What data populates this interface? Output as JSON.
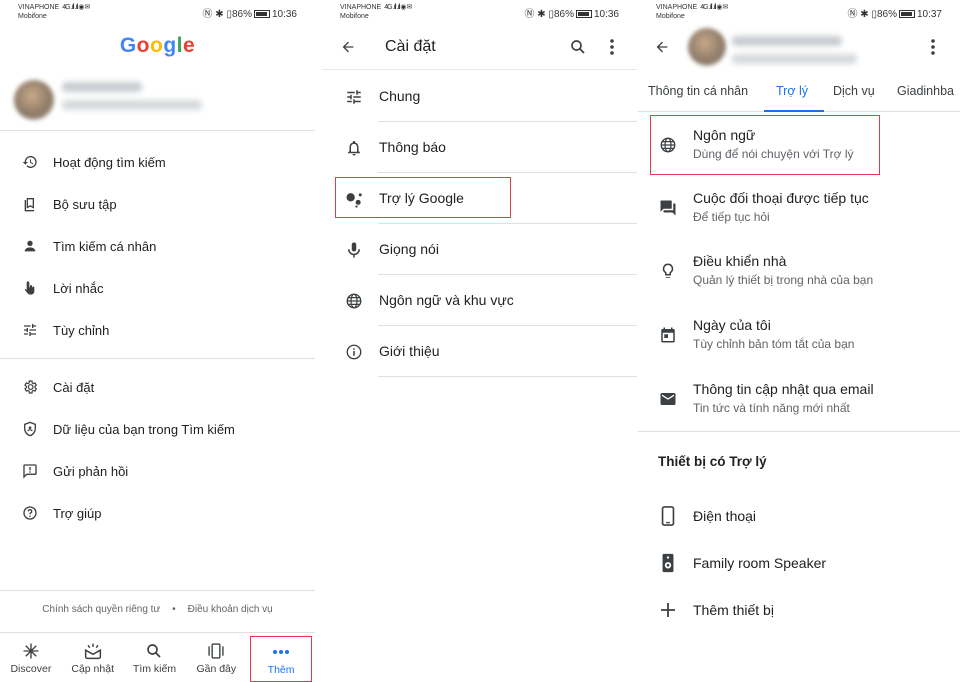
{
  "colors": {
    "accent": "#1a73e8",
    "highlight": "#e53950",
    "text": "#202124",
    "secondary": "#5f6368"
  },
  "status": {
    "left": {
      "carrier1": "VINAPHONE",
      "carrier2": "Mobifone"
    },
    "right": {
      "battery": "86%",
      "time1": "10:36",
      "time2": "10:36",
      "time3": "10:37"
    }
  },
  "panel1": {
    "logo": "Google",
    "menu": [
      {
        "label": "Hoạt động tìm kiếm",
        "icon": "history-icon"
      },
      {
        "label": "Bộ sưu tập",
        "icon": "collections-icon"
      },
      {
        "label": "Tìm kiếm cá nhân",
        "icon": "person-icon"
      },
      {
        "label": "Lời nhắc",
        "icon": "reminder-hand-icon"
      },
      {
        "label": "Tùy chỉnh",
        "icon": "tune-icon"
      },
      {
        "label": "Cài đặt",
        "icon": "gear-icon"
      },
      {
        "label": "Dữ liệu của bạn trong Tìm kiếm",
        "icon": "shield-icon"
      },
      {
        "label": "Gửi phản hồi",
        "icon": "feedback-icon"
      },
      {
        "label": "Trợ giúp",
        "icon": "help-icon"
      }
    ],
    "footer": {
      "privacy": "Chính sách quyền riêng tư",
      "sep": "•",
      "terms": "Điều khoản dịch vụ"
    },
    "nav": [
      {
        "label": "Discover",
        "icon": "asterisk-icon"
      },
      {
        "label": "Cập nhật",
        "icon": "updates-icon"
      },
      {
        "label": "Tìm kiếm",
        "icon": "search-icon"
      },
      {
        "label": "Gần đây",
        "icon": "recent-icon"
      },
      {
        "label": "Thêm",
        "icon": "more-dots-icon"
      }
    ]
  },
  "panel2": {
    "title": "Cài đặt",
    "items": [
      {
        "label": "Chung",
        "icon": "tune-icon"
      },
      {
        "label": "Thông báo",
        "icon": "bell-icon"
      },
      {
        "label": "Trợ lý Google",
        "icon": "assistant-icon"
      },
      {
        "label": "Giọng nói",
        "icon": "mic-icon"
      },
      {
        "label": "Ngôn ngữ và khu vực",
        "icon": "globe-icon"
      },
      {
        "label": "Giới thiệu",
        "icon": "info-icon"
      }
    ]
  },
  "panel3": {
    "tabs": [
      "Thông tin cá nhân",
      "Trợ lý",
      "Dịch vụ",
      "Giadinhba"
    ],
    "items": [
      {
        "title": "Ngôn ngữ",
        "subtitle": "Dùng để nói chuyện với Trợ lý",
        "icon": "globe-icon"
      },
      {
        "title": "Cuộc đối thoại được tiếp tục",
        "subtitle": "Để tiếp tục hỏi",
        "icon": "chat-icon"
      },
      {
        "title": "Điều khiển nhà",
        "subtitle": "Quản lý thiết bị trong nhà của bạn",
        "icon": "lightbulb-icon"
      },
      {
        "title": "Ngày của tôi",
        "subtitle": "Tùy chỉnh bản tóm tắt của bạn",
        "icon": "calendar-icon"
      },
      {
        "title": "Thông tin cập nhật qua email",
        "subtitle": "Tin tức và tính năng mới nhất",
        "icon": "mail-icon"
      }
    ],
    "section": "Thiết bị có Trợ lý",
    "devices": [
      {
        "label": "Điện thoại",
        "icon": "phone-icon"
      },
      {
        "label": "Family room Speaker",
        "icon": "speaker-icon"
      },
      {
        "label": "Thêm thiết bị",
        "icon": "plus-icon"
      }
    ]
  }
}
